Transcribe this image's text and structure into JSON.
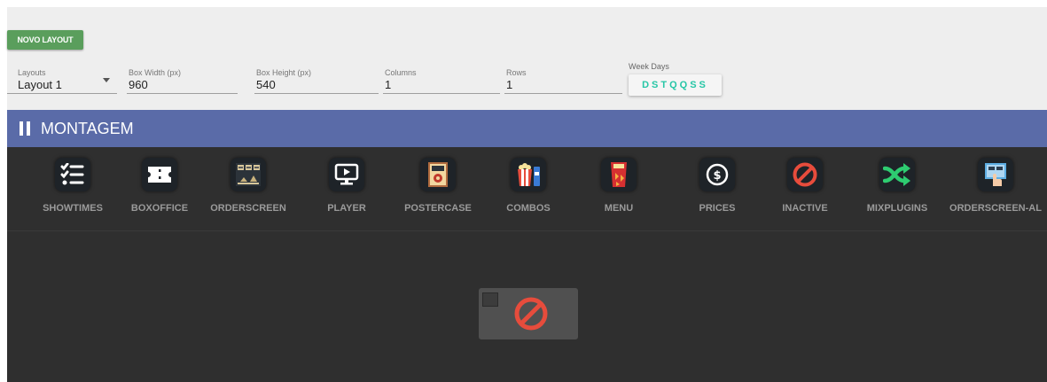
{
  "toolbar": {
    "new_layout_label": "NOVO LAYOUT"
  },
  "fields": {
    "layouts": {
      "label": "Layouts",
      "value": "Layout 1"
    },
    "box_width": {
      "label": "Box Width (px)",
      "value": "960"
    },
    "box_height": {
      "label": "Box Height (px)",
      "value": "540"
    },
    "columns": {
      "label": "Columns",
      "value": "1"
    },
    "rows": {
      "label": "Rows",
      "value": "1"
    },
    "week_days": {
      "label": "Week Days",
      "value": "DSTQQSS"
    }
  },
  "header": {
    "title": "MONTAGEM"
  },
  "plugins": [
    {
      "label": "SHOWTIMES",
      "icon": "checklist-icon"
    },
    {
      "label": "BOXOFFICE",
      "icon": "ticket-icon"
    },
    {
      "label": "ORDERSCREEN",
      "icon": "order-screen-icon"
    },
    {
      "label": "PLAYER",
      "icon": "monitor-play-icon"
    },
    {
      "label": "POSTERCASE",
      "icon": "poster-icon"
    },
    {
      "label": "COMBOS",
      "icon": "popcorn-icon"
    },
    {
      "label": "MENU",
      "icon": "menu-bag-icon"
    },
    {
      "label": "PRICES",
      "icon": "dollar-icon"
    },
    {
      "label": "INACTIVE",
      "icon": "ban-icon"
    },
    {
      "label": "MIXPLUGINS",
      "icon": "shuffle-icon"
    },
    {
      "label": "ORDERSCREEN-AL",
      "icon": "touch-screen-icon"
    }
  ],
  "colors": {
    "header": "#5a6ba8",
    "accent_green": "#5a9e5c",
    "weekdays_text": "#26c6a6",
    "dark_bg": "#2f2f2f",
    "ban_red": "#e74c3c"
  }
}
